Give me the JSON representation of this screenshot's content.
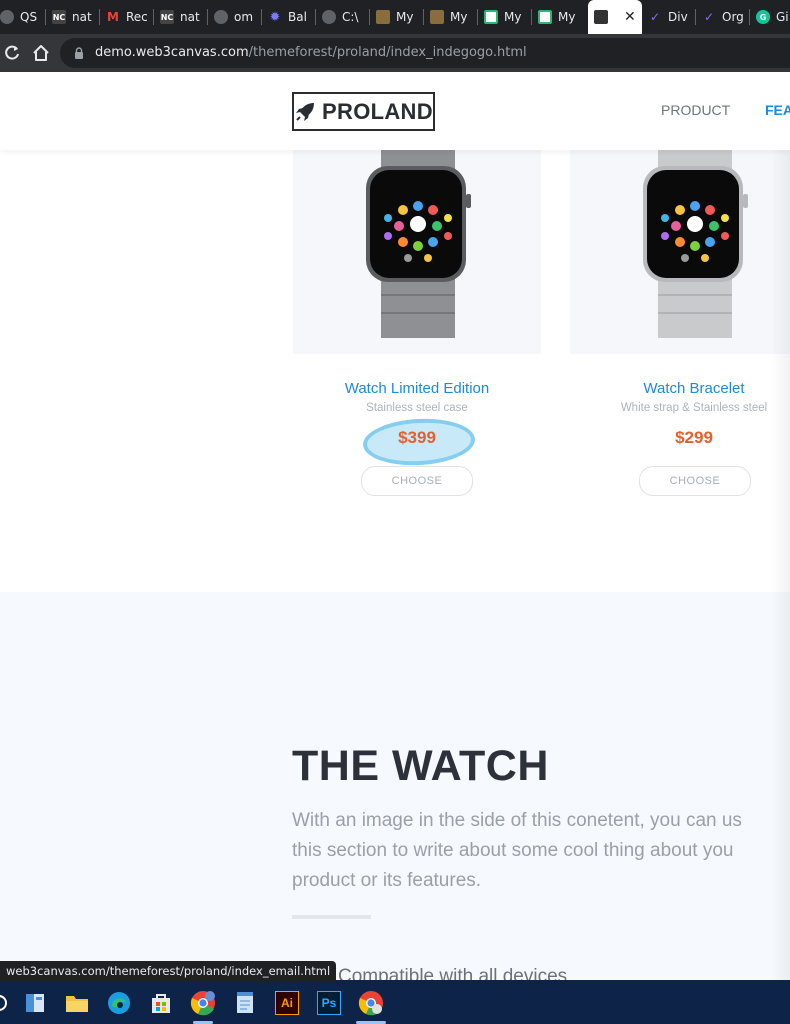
{
  "browser": {
    "tabs": [
      {
        "label": "QS",
        "icon": "globe-icon",
        "color": "#9aa0a6"
      },
      {
        "label": "nat",
        "icon": "nc-icon",
        "color": "#444444"
      },
      {
        "label": "Rec",
        "icon": "gmail-icon",
        "color": "#ea4335"
      },
      {
        "label": "nat",
        "icon": "nc-icon",
        "color": "#444444"
      },
      {
        "label": "om",
        "icon": "globe-icon",
        "color": "#9aa0a6"
      },
      {
        "label": "Bal",
        "icon": "gear-icon",
        "color": "#6b6bff"
      },
      {
        "label": "C:\\",
        "icon": "globe-icon",
        "color": "#9aa0a6"
      },
      {
        "label": "My",
        "icon": "book-icon",
        "color": "#8a6d3b"
      },
      {
        "label": "My",
        "icon": "book-icon",
        "color": "#8a6d3b"
      },
      {
        "label": "My",
        "icon": "monitor-icon",
        "color": "#34a853"
      },
      {
        "label": "My",
        "icon": "monitor-icon",
        "color": "#34a853"
      },
      {
        "label": "",
        "icon": "page-icon",
        "color": "#444444",
        "active": true
      },
      {
        "label": "Div",
        "icon": "check-icon",
        "color": "#7c5cff"
      },
      {
        "label": "Org",
        "icon": "check-icon",
        "color": "#7c5cff"
      },
      {
        "label": "Gi",
        "icon": "grammarly-icon",
        "color": "#15c39a"
      }
    ],
    "url_host": "demo.web3canvas.com",
    "url_path": "/themeforest/proland/index_indegogo.html",
    "status_url": "web3canvas.com/themeforest/proland/index_email.html"
  },
  "header": {
    "logo_text": "PROLAND",
    "nav": [
      "PRODUCT",
      "FEA"
    ],
    "nav_colors": [
      "#6f747b",
      "#1f8ad6"
    ]
  },
  "products": [
    {
      "name": "Watch Limited Edition",
      "subtitle": "Stainless steel case",
      "price": "$399",
      "button": "CHOOSE"
    },
    {
      "name": "Watch Bracelet",
      "subtitle": "White strap & Stainless steel",
      "price": "$299",
      "button": "CHOOSE"
    }
  ],
  "section": {
    "title": "THE WATCH",
    "text_lines": [
      "With an image in the side of this conetent, you can us",
      "this section to write about some cool thing about you",
      "product or its features."
    ],
    "feature": "Compatible with all devices"
  },
  "taskbar": {
    "icons": [
      "search-icon",
      "file-manager-icon",
      "folder-icon",
      "edge-icon",
      "store-icon",
      "chrome-icon",
      "notepad-icon",
      "illustrator-icon",
      "photoshop-icon",
      "chrome-profile-icon"
    ],
    "illustrator_label": "Ai",
    "photoshop_label": "Ps"
  },
  "colors": {
    "accent": "#1f8ad6",
    "price": "#e5602a",
    "highlight": "#86cef0"
  }
}
